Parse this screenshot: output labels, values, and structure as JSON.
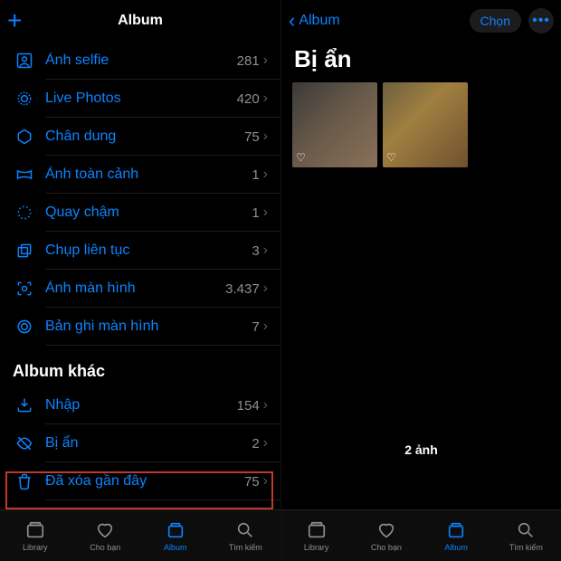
{
  "left": {
    "header": {
      "title": "Album"
    },
    "rows": [
      {
        "label": "Ảnh selfie",
        "count": "281"
      },
      {
        "label": "Live Photos",
        "count": "420"
      },
      {
        "label": "Chân dung",
        "count": "75"
      },
      {
        "label": "Ảnh toàn cảnh",
        "count": "1"
      },
      {
        "label": "Quay chậm",
        "count": "1"
      },
      {
        "label": "Chụp liên tục",
        "count": "3"
      },
      {
        "label": "Ảnh màn hình",
        "count": "3.437"
      },
      {
        "label": "Bản ghi màn hình",
        "count": "7"
      }
    ],
    "section_other": "Album khác",
    "rows2": [
      {
        "label": "Nhập",
        "count": "154"
      },
      {
        "label": "Bị ẩn",
        "count": "2"
      },
      {
        "label": "Đã xóa gần đây",
        "count": "75"
      }
    ]
  },
  "right": {
    "header": {
      "back": "Album",
      "select": "Chọn"
    },
    "title": "Bị ẩn",
    "count_label": "2 ảnh"
  },
  "tabs": [
    "Library",
    "Cho bạn",
    "Album",
    "Tìm kiếm"
  ],
  "colors": {
    "accent": "#0A84FF",
    "highlight": "#c0392b"
  }
}
